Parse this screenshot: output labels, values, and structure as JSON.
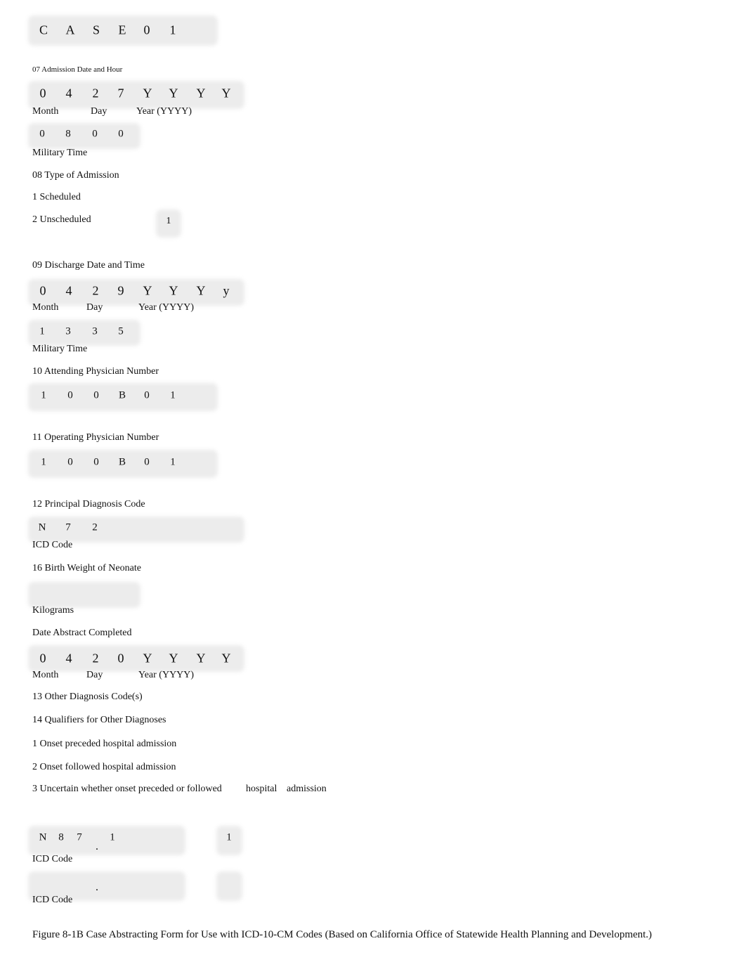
{
  "case_id": [
    "C",
    "A",
    "S",
    "E",
    "0",
    "1"
  ],
  "admission": {
    "title": "07 Admission Date and Hour",
    "date": [
      "0",
      "4",
      "2",
      "7",
      "Y",
      "Y",
      "Y",
      "Y"
    ],
    "month_label": "Month",
    "day_label": "Day",
    "year_label": "Year (YYYY)",
    "time": [
      "0",
      "8",
      "0",
      "0"
    ],
    "time_label": "Military Time"
  },
  "admission_type": {
    "title": "08 Type of Admission",
    "option_1": "1 Scheduled",
    "option_2": "2 Unscheduled",
    "value": "1"
  },
  "discharge": {
    "title": "09 Discharge Date and Time",
    "date": [
      "0",
      "4",
      "2",
      "9",
      "Y",
      "Y",
      "Y",
      "y"
    ],
    "month_label": "Month",
    "day_label": "Day",
    "year_label": "Year (YYYY)",
    "time": [
      "1",
      "3",
      "3",
      "5"
    ],
    "time_label": "Military Time"
  },
  "attending": {
    "title": "10 Attending Physician Number",
    "value": [
      "1",
      "0",
      "0",
      "B",
      "0",
      "1"
    ]
  },
  "operating": {
    "title": "11 Operating Physician Number",
    "value": [
      "1",
      "0",
      "0",
      "B",
      "0",
      "1"
    ]
  },
  "principal_dx": {
    "title": "12 Principal Diagnosis Code",
    "value": [
      "N",
      "7",
      "2"
    ],
    "label": "ICD Code"
  },
  "birth_weight": {
    "title": "16 Birth Weight of Neonate",
    "label": "Kilograms"
  },
  "abstract_date": {
    "title": "Date Abstract Completed",
    "date": [
      "0",
      "4",
      "2",
      "0",
      "Y",
      "Y",
      "Y",
      "Y"
    ],
    "month_label": "Month",
    "day_label": "Day",
    "year_label": "Year (YYYY)"
  },
  "other_dx": {
    "title": "13 Other Diagnosis Code(s)",
    "qualifiers_title": "14 Qualifiers for Other Diagnoses",
    "q1": "1 Onset preceded hospital admission",
    "q2": "2 Onset followed hospital admission",
    "q3a": "3 Uncertain whether onset preceded or followed",
    "q3b": "hospital",
    "q3c": "admission",
    "rows": [
      {
        "code": [
          "N",
          "8",
          "7"
        ],
        "dot": ".",
        "suffix": "1",
        "qualifier": "1",
        "label": "ICD Code"
      },
      {
        "code": [],
        "dot": ".",
        "suffix": "",
        "qualifier": "",
        "label": "ICD Code"
      }
    ]
  },
  "caption": "Figure 8-1B Case Abstracting Form for Use with ICD-10-CM Codes (Based on California Office of Statewide Health Planning and Development.)"
}
